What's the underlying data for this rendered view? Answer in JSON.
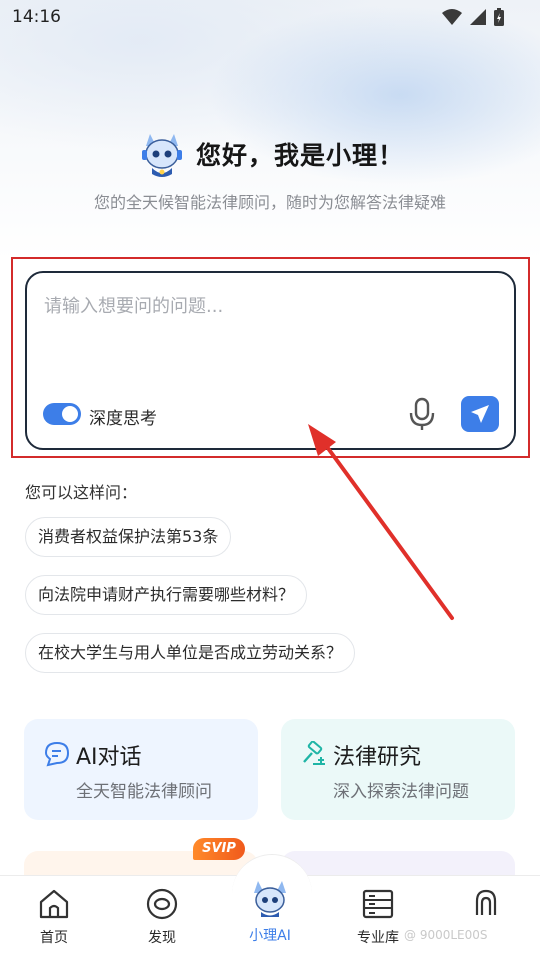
{
  "status_bar": {
    "time": "14:16"
  },
  "hero": {
    "title": "您好，我是小理！",
    "subtitle": "您的全天候智能法律顾问，随时为您解答法律疑难"
  },
  "input": {
    "placeholder": "请输入想要问的问题...",
    "deep_think_label": "深度思考",
    "deep_think_on": true
  },
  "suggestions": {
    "heading": "您可以这样问：",
    "items": [
      "消费者权益保护法第53条",
      "向法院申请财产执行需要哪些材料？",
      "在校大学生与用人单位是否成立劳动关系？"
    ]
  },
  "cards": [
    {
      "title": "AI对话",
      "subtitle": "全天智能法律顾问"
    },
    {
      "title": "法律研究",
      "subtitle": "深入探索法律问题"
    }
  ],
  "svip_badge": "SVIP",
  "nav": [
    {
      "label": "首页"
    },
    {
      "label": "发现"
    },
    {
      "label": "小理AI"
    },
    {
      "label": "专业库"
    },
    {
      "label": ""
    }
  ],
  "watermark": "@ 9000LE00S",
  "colors": {
    "accent": "#3d7ee8",
    "annotation": "#d32b2b"
  }
}
